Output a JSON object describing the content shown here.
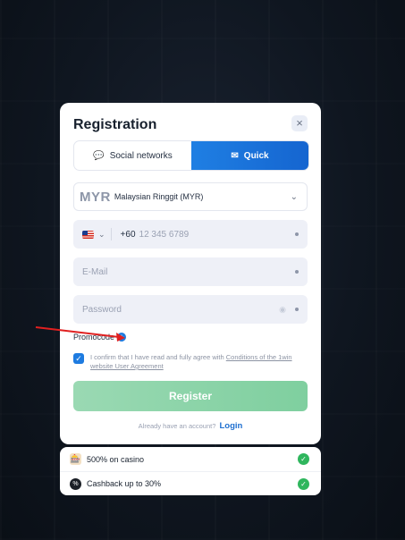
{
  "modal": {
    "title": "Registration",
    "close_icon": "×",
    "tabs": [
      {
        "label": "Social networks",
        "icon": "chat-icon"
      },
      {
        "label": "Quick",
        "icon": "envelope-icon",
        "active": true
      }
    ],
    "currency": {
      "code": "MYR",
      "name": "Malaysian Ringgit (MYR)"
    },
    "phone": {
      "country_code": "+60",
      "placeholder": "12 345 6789"
    },
    "email": {
      "placeholder": "E-Mail"
    },
    "password": {
      "placeholder": "Password"
    },
    "promocode_label": "Promocode",
    "agreement": {
      "text": "I confirm that I have read and fully agree with",
      "link": "Conditions of the 1win website User Agreement",
      "checked": true
    },
    "register_label": "Register",
    "login_prompt": "Already have an account?",
    "login_link": "Login"
  },
  "bonuses": [
    {
      "label": "500% on casino",
      "icon": "casino-icon"
    },
    {
      "label": "Cashback up to 30%",
      "icon": "cashback-icon"
    }
  ],
  "colors": {
    "accent": "#1e7be0",
    "register": "#8cd4a9",
    "success": "#2fb65d",
    "annotation": "#e02020"
  }
}
